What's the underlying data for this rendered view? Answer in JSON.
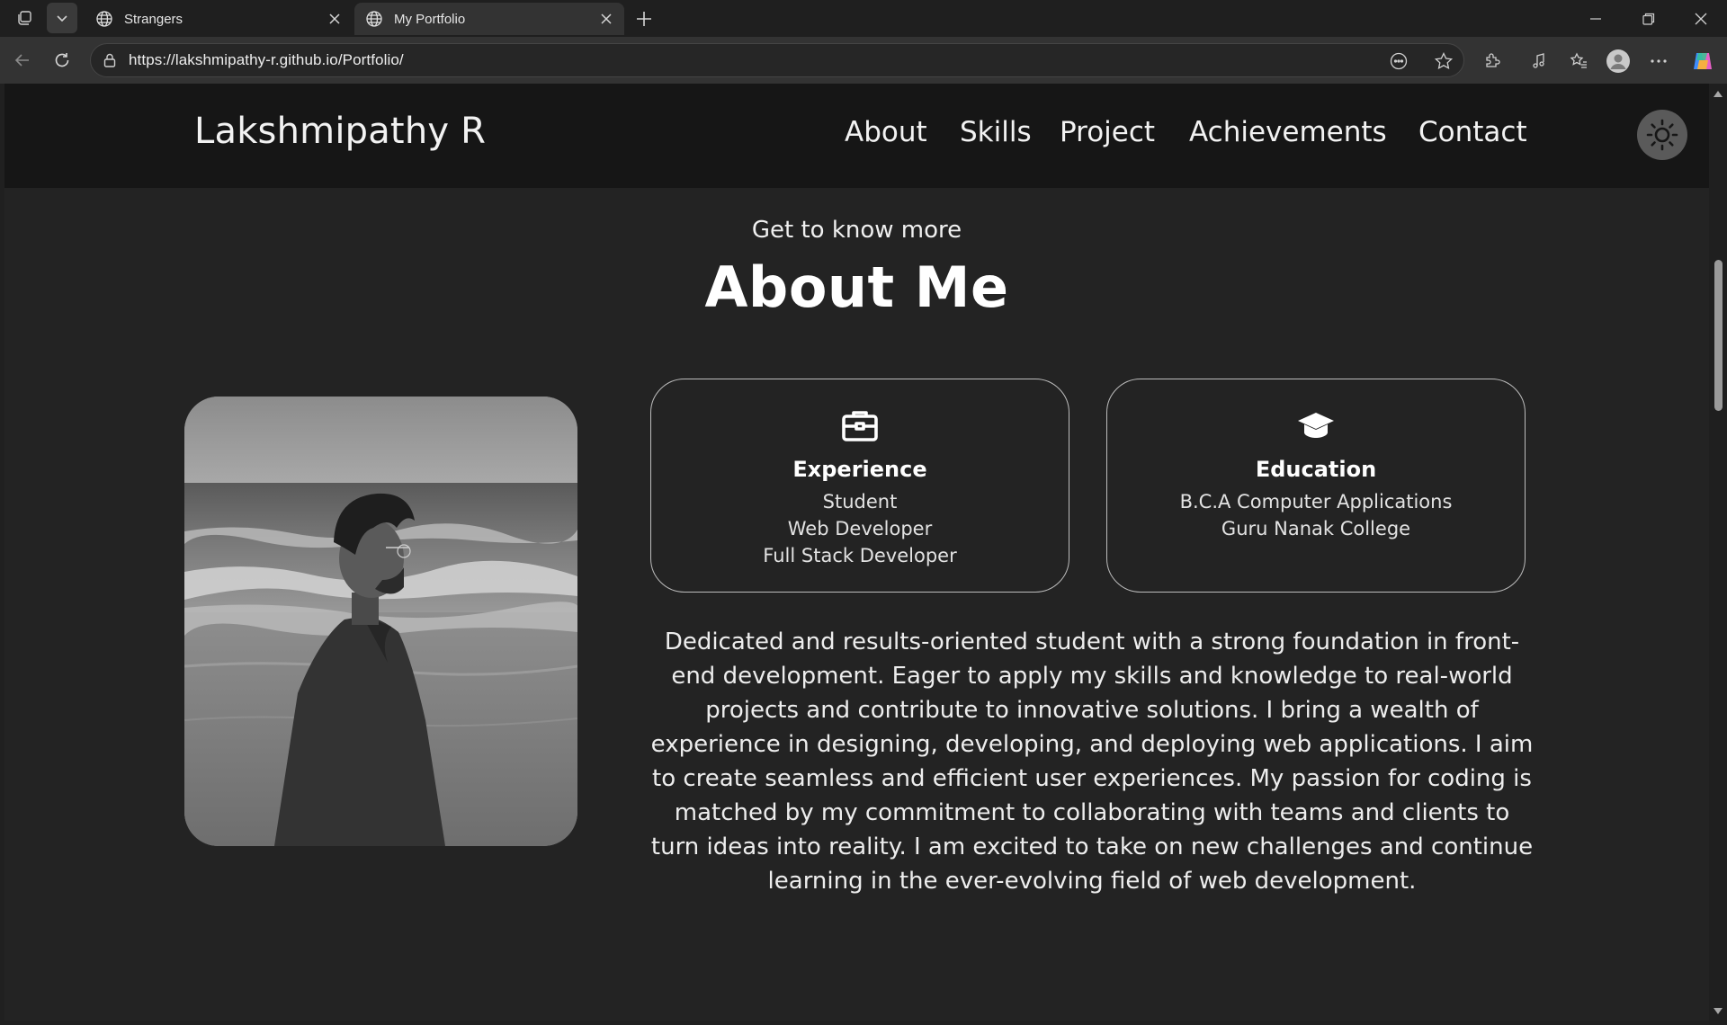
{
  "browser": {
    "tabs": [
      {
        "title": "Strangers",
        "active": false
      },
      {
        "title": "My Portfolio",
        "active": true
      }
    ],
    "url": "https://lakshmipathy-r.github.io/Portfolio/"
  },
  "header": {
    "logo": "Lakshmipathy R",
    "nav": [
      "About",
      "Skills",
      "Project",
      "Achievements",
      "Contact"
    ],
    "theme_toggle_icon": "sun-icon"
  },
  "about": {
    "subtitle": "Get to know more",
    "title": "About Me",
    "cards": [
      {
        "icon": "briefcase-icon",
        "title": "Experience",
        "lines": [
          "Student",
          "Web Developer",
          "Full Stack Developer"
        ]
      },
      {
        "icon": "graduation-cap-icon",
        "title": "Education",
        "lines": [
          "B.C.A Computer Applications",
          "Guru Nanak College"
        ]
      }
    ],
    "paragraph": "Dedicated and results-oriented student with a strong foundation in front-end development. Eager to apply my skills and knowledge to real-world projects and contribute to innovative solutions. I bring a wealth of experience in designing, developing, and deploying web applications. I aim to create seamless and efficient user experiences. My passion for coding is matched by my commitment to collaborating with teams and clients to turn ideas into reality. I am excited to take on new challenges and continue learning in the ever-evolving field of web development."
  },
  "colors": {
    "page_bg": "#232323",
    "header_bg": "#161616",
    "text": "#f2f2f2"
  }
}
